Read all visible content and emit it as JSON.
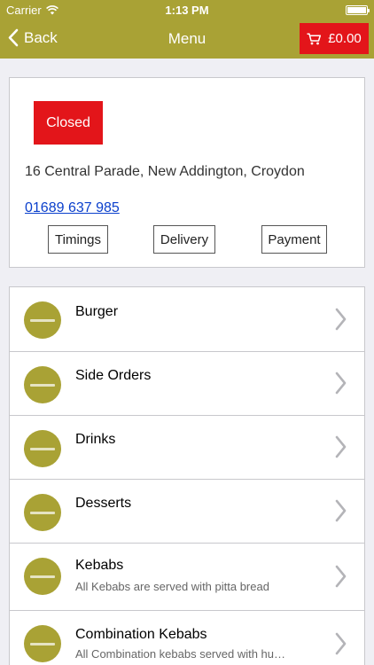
{
  "status_bar": {
    "carrier": "Carrier",
    "time": "1:13 PM"
  },
  "nav": {
    "back_label": "Back",
    "title": "Menu",
    "cart_total": "£0.00"
  },
  "restaurant": {
    "status": "Closed",
    "address": "16 Central Parade, New Addington, Croydon",
    "phone": "01689 637 985",
    "buttons": {
      "timings": "Timings",
      "delivery": "Delivery",
      "payment": "Payment"
    }
  },
  "categories": [
    {
      "name": "Burger",
      "description": ""
    },
    {
      "name": "Side Orders",
      "description": ""
    },
    {
      "name": "Drinks",
      "description": ""
    },
    {
      "name": "Desserts",
      "description": ""
    },
    {
      "name": "Kebabs",
      "description": "All Kebabs are served with pitta bread"
    },
    {
      "name": "Combination Kebabs",
      "description": "All Combination kebabs served with hu…"
    }
  ],
  "colors": {
    "brand": "#a9a235",
    "accent_red": "#e3151a",
    "link": "#0a3fcc"
  },
  "icons": {
    "back": "chevron-left-icon",
    "cart": "shopping-cart-icon",
    "row": "chevron-right-icon",
    "wifi": "wifi-icon",
    "battery": "battery-icon",
    "logo": "restaurant-logo"
  }
}
